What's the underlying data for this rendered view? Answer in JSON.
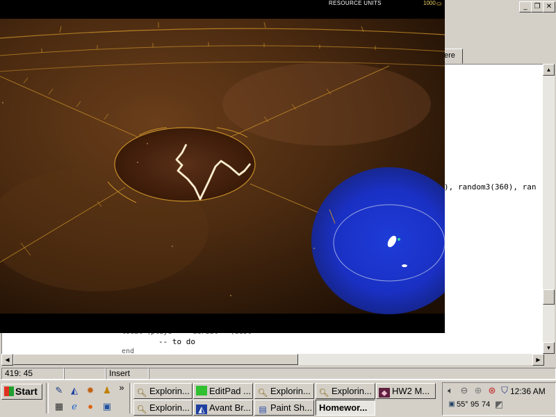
{
  "editor": {
    "tab_label": "ere",
    "code_line_1": "), random3(360), ran",
    "code_line_2": "        -- to do",
    "code_line_3_partial": "local (playe     aerial   (dest",
    "code_line_4_partial": "end",
    "window_buttons": [
      "_",
      "❐",
      "✕"
    ]
  },
  "statusbar": {
    "position": "419: 45",
    "empty": "",
    "mode": "Insert"
  },
  "game": {
    "resource_label": "RESOURCE UNITS",
    "resource_value": "1000",
    "resource_icon": "resource-icon"
  },
  "taskbar": {
    "start_label": "Start",
    "quick_launch": [
      "notepad-icon",
      "avant-icon",
      "paint-icon",
      "aim-icon",
      "calculator-icon",
      "ie-icon",
      "firefox-icon",
      "desktop-icon"
    ],
    "more_chevron": "»",
    "tasks_row1": [
      {
        "label": "Explorin...",
        "icon": "folder-search-icon"
      },
      {
        "label": "EditPad ...",
        "icon": "editpad-icon"
      },
      {
        "label": "Explorin...",
        "icon": "folder-search-icon"
      },
      {
        "label": "Explorin...",
        "icon": "folder-search-icon"
      },
      {
        "label": "HW2 M...",
        "icon": "hw2-icon"
      }
    ],
    "tasks_row2": [
      {
        "label": "Explorin...",
        "icon": "folder-search-icon"
      },
      {
        "label": "Avant Br...",
        "icon": "avant-icon"
      },
      {
        "label": "Paint Sh...",
        "icon": "paintshop-icon"
      },
      {
        "label": "Homewor...",
        "icon": "",
        "active": true
      }
    ],
    "tray_temps": [
      "55°",
      "95",
      "74"
    ],
    "clock": "12:36 AM"
  },
  "colors": {
    "window_bg": "#d4d0c8",
    "game_bg": "#3a1e08",
    "hud_gold": "#c8902a",
    "nebula_blue": "#1830c8"
  }
}
